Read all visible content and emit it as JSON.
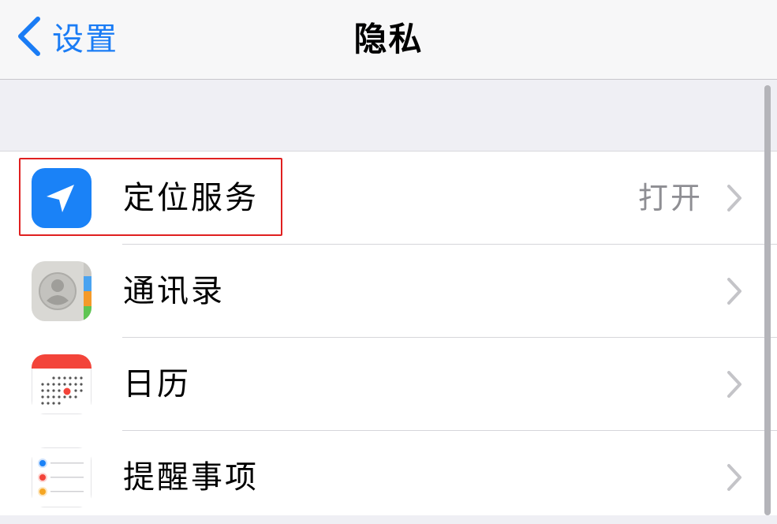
{
  "navbar": {
    "back_label": "设置",
    "title": "隐私"
  },
  "list": {
    "items": [
      {
        "label": "定位服务",
        "value": "打开",
        "icon": "location-arrow-icon",
        "icon_color": "#1a82f7"
      },
      {
        "label": "通讯录",
        "value": "",
        "icon": "contacts-icon",
        "icon_color": "#d9d8d4"
      },
      {
        "label": "日历",
        "value": "",
        "icon": "calendar-icon",
        "icon_color": "#f3443a"
      },
      {
        "label": "提醒事项",
        "value": "",
        "icon": "reminders-icon",
        "icon_color": "#ffffff"
      }
    ]
  },
  "colors": {
    "accent": "#1a7cf5",
    "highlight_box": "#e02020",
    "background": "#efeff4"
  }
}
